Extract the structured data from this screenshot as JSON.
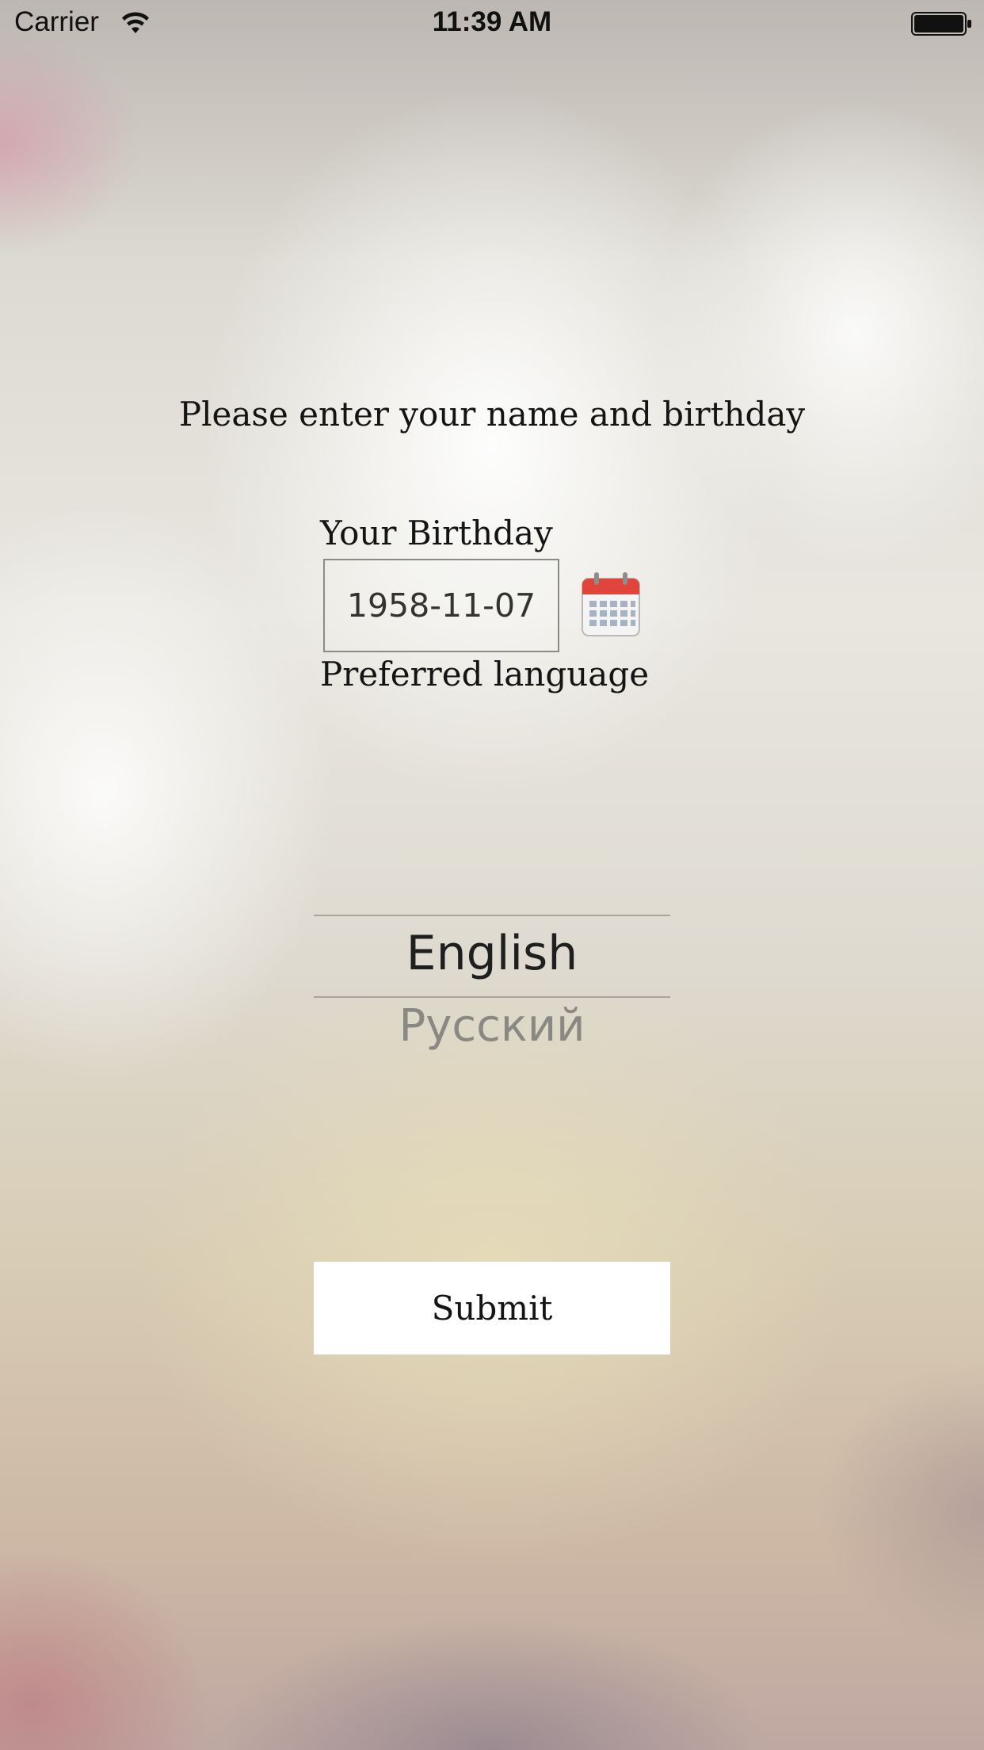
{
  "status_bar": {
    "carrier": "Carrier",
    "time": "11:39 AM",
    "wifi_icon": "wifi-icon",
    "battery_icon": "battery-full-icon"
  },
  "form": {
    "prompt": "Please enter your name and birthday",
    "birthday_label": "Your Birthday",
    "birthday_value": "1958-11-07",
    "calendar_icon": "calendar-icon",
    "language_label": "Preferred language",
    "language_options": [
      "English",
      "Русский"
    ],
    "selected_language": "English",
    "submit_label": "Submit"
  },
  "colors": {
    "text": "#141414",
    "picker_unselected": "#8a8882",
    "button_bg": "#ffffff",
    "calendar_red": "#e0443b"
  }
}
